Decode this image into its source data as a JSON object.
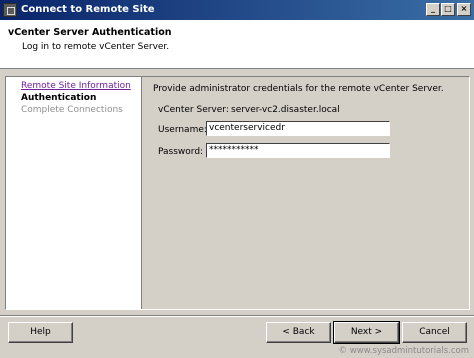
{
  "window": {
    "title": "Connect to Remote Site",
    "controls": {
      "minimize": "_",
      "maximize": "□",
      "close": "×"
    },
    "icon": "vmware-app-icon"
  },
  "header": {
    "title": "vCenter Server Authentication",
    "subtitle": "Log in to remote vCenter Server."
  },
  "nav": {
    "items": [
      {
        "label": "Remote Site Information",
        "state": "link"
      },
      {
        "label": "Authentication",
        "state": "current"
      },
      {
        "label": "Complete Connections",
        "state": "disabled"
      }
    ]
  },
  "form": {
    "intro": "Provide administrator credentials for the remote vCenter Server.",
    "server_label": "vCenter Server:",
    "server_value": "server-vc2.disaster.local",
    "username_label": "Username:",
    "username_value": "vcenterservicedr",
    "password_label": "Password:",
    "password_value": "***********"
  },
  "buttons": {
    "help": "Help",
    "back": "< Back",
    "next": "Next >",
    "cancel": "Cancel"
  },
  "watermark": "© www.sysadmintutorials.com"
}
